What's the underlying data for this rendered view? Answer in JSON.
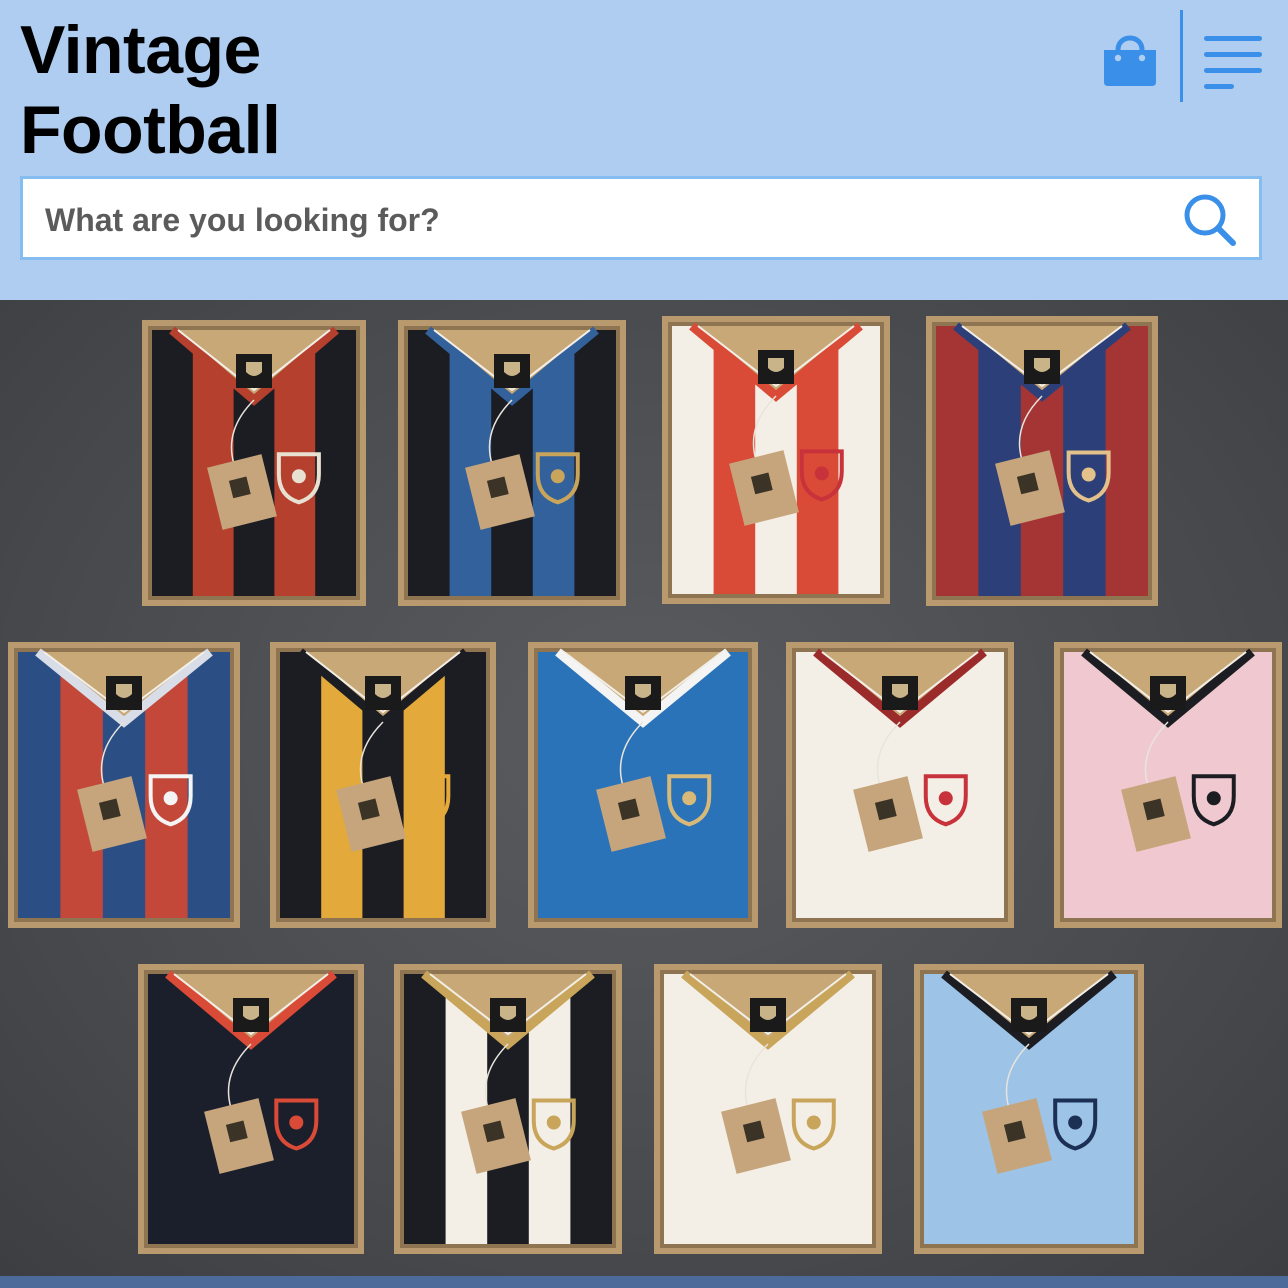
{
  "header": {
    "brand_line1": "Vintage",
    "brand_line2": "Football",
    "bag_icon": "shopping-bag-icon",
    "menu_icon": "hamburger-menu-icon",
    "accent_color": "#3a8fe8",
    "background_color": "#aecdf0"
  },
  "search": {
    "placeholder": "What are you looking for?",
    "value": "",
    "icon": "search-icon"
  },
  "hero": {
    "icon": "shirt-collection-image",
    "shirts": [
      {
        "stripes": [
          "#1c1d22",
          "#b5402e"
        ],
        "collar": "#b5402e",
        "badge": "shield-crest-icon",
        "badge_color": "#e8e0d0"
      },
      {
        "stripes": [
          "#1c1d22",
          "#33619b"
        ],
        "collar": "#33619b",
        "badge": "serpent-icon",
        "badge_color": "#c8a55a"
      },
      {
        "stripes": [
          "#f4efe6",
          "#d94b36"
        ],
        "collar": "#d94b36",
        "badge": "checkered-shield-icon",
        "badge_color": "#c8323a"
      },
      {
        "stripes": [
          "#a53535",
          "#2c3f78"
        ],
        "collar": "#2c3f78",
        "badge": "football-crest-icon",
        "badge_color": "#e2c28a"
      },
      {
        "stripes": [
          "#2b4f85",
          "#c4483a"
        ],
        "collar": "#d8dde8",
        "badge": "eiffel-tower-icon",
        "badge_color": "#f4f4f4"
      },
      {
        "stripes": [
          "#1c1d22",
          "#e3a93a"
        ],
        "collar": "#1c1d22",
        "badge": "lion-icon",
        "badge_color": "#e3a93a"
      },
      {
        "stripes": [
          "#2b73b8"
        ],
        "collar": "#f4f4f4",
        "badge": "lion-rampant-icon",
        "badge_color": "#d8b978"
      },
      {
        "stripes": [
          "#f4efe6"
        ],
        "collar": "#9b2a2a",
        "badge": "liver-bird-icon",
        "badge_color": "#c8323a"
      },
      {
        "stripes": [
          "#f0c9d0"
        ],
        "collar": "#1c1d22",
        "badge": "zebra-icon",
        "badge_color": "#1c1d22"
      },
      {
        "stripes": [
          "#1b1e2b"
        ],
        "collar": "#d94b36",
        "badge": "devil-icon",
        "badge_color": "#d94b36"
      },
      {
        "stripes": [
          "#1c1d22",
          "#f4efe6"
        ],
        "collar": "#c8a55a",
        "badge": "zebra-icon",
        "badge_color": "#c8a55a"
      },
      {
        "stripes": [
          "#f4efe6"
        ],
        "collar": "#c8a55a",
        "badge": "crown-monogram-icon",
        "badge_color": "#c8a55a"
      },
      {
        "stripes": [
          "#9dc3e6"
        ],
        "collar": "#1c1d22",
        "badge": "ship-icon",
        "badge_color": "#1c2f55"
      }
    ]
  }
}
